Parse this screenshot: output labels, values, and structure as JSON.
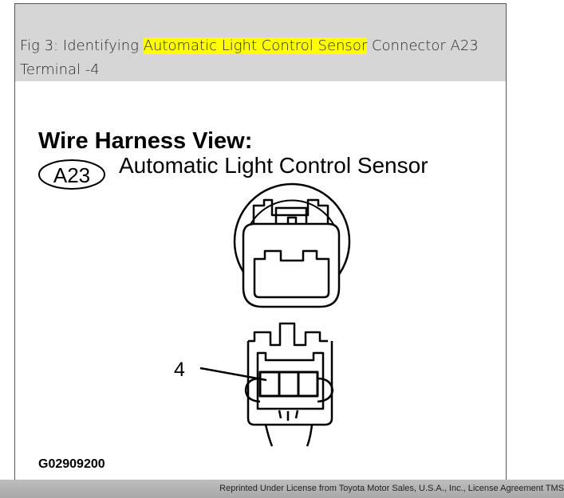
{
  "caption": {
    "prefix": "Fig 3: Identifying ",
    "highlight": "Automatic Light Control Sensor",
    "suffix": " Connector A23 Terminal -4",
    "highlight_color": "#ffff00"
  },
  "diagram": {
    "view_title": "Wire Harness View:",
    "connector_code": "A23",
    "connector_name": "Automatic Light Control Sensor",
    "terminal_label": "4",
    "figure_id": "G02909200"
  },
  "footer": {
    "notice": "Reprinted Under License from Toyota Motor Sales, U.S.A., Inc., License Agreement TMS"
  }
}
